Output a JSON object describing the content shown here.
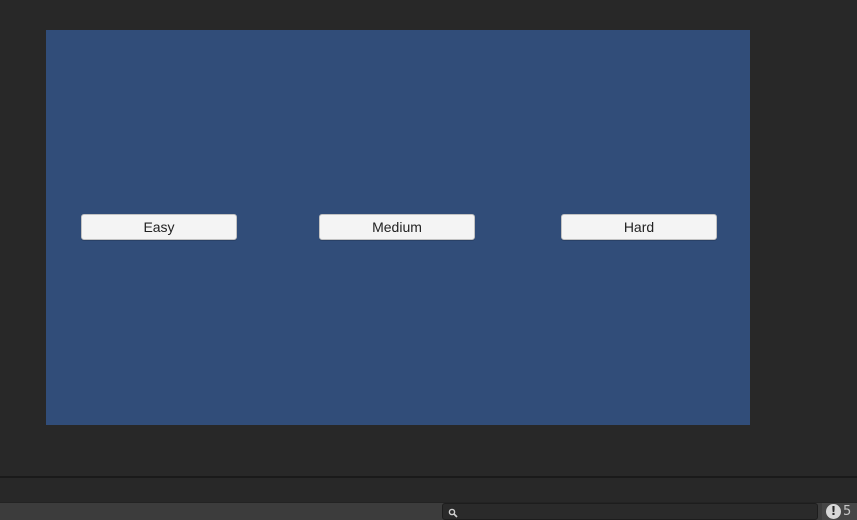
{
  "game": {
    "canvas_color": "#314d79",
    "buttons": {
      "easy": "Easy",
      "medium": "Medium",
      "hard": "Hard"
    }
  },
  "console": {
    "search": {
      "value": "",
      "placeholder": ""
    },
    "error_icon": "!",
    "error_count": "5"
  }
}
